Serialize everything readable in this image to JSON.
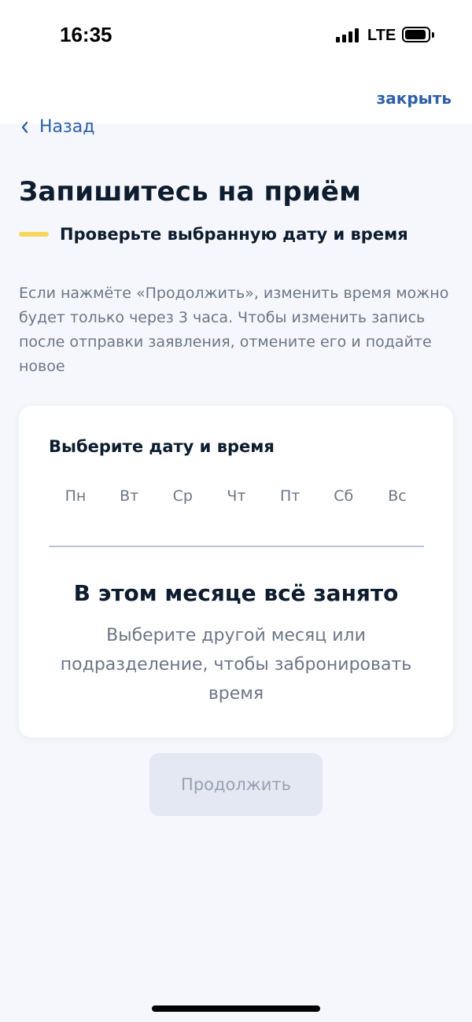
{
  "status_bar": {
    "time": "16:35",
    "network": "LTE",
    "icons": [
      "signal-icon",
      "battery-icon"
    ]
  },
  "header": {
    "close_label": "закрыть",
    "back_label": "Назад",
    "back_icon": "chevron-left-icon"
  },
  "main": {
    "title": "Запишитесь на приём",
    "subtitle": "Проверьте выбранную дату и время",
    "info": "Если нажмёте «Продолжить», изменить время можно будет только через 3 часа. Чтобы изменить запись после отправки заявления, отмените его и подайте новое"
  },
  "calendar": {
    "title": "Выберите дату и время",
    "weekdays": [
      "Пн",
      "Вт",
      "Ср",
      "Чт",
      "Пт",
      "Сб",
      "Вс"
    ],
    "empty_title": "В этом месяце всё занято",
    "empty_description": "Выберите другой месяц или подразделение, чтобы забронировать время"
  },
  "actions": {
    "continue_label": "Продолжить",
    "continue_disabled": true
  },
  "colors": {
    "accent": "#2e5fa8",
    "title_text": "#0d1c2e",
    "secondary_text": "#6b7686",
    "subtitle_bar": "#f8d55c",
    "background": "#f5f7fc",
    "disabled_button": "#e3e8f2"
  }
}
